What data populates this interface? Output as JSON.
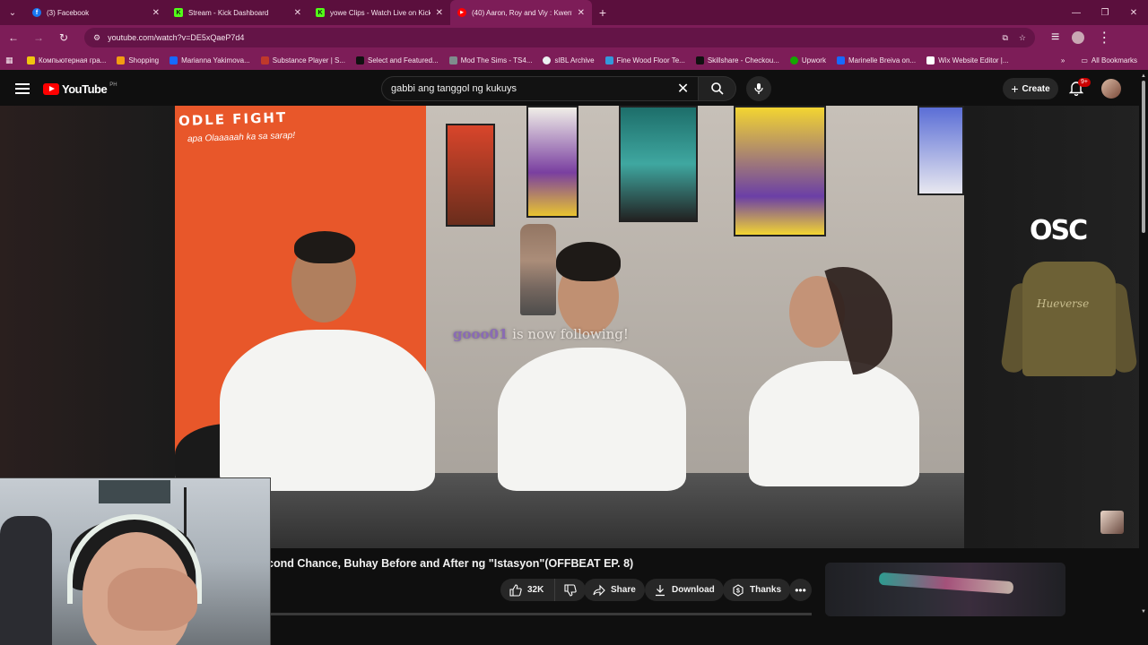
{
  "browser": {
    "tabs": [
      {
        "label": "(3) Facebook",
        "fav_color": "#1877f2",
        "fav_glyph": "f"
      },
      {
        "label": "Stream - Kick Dashboard",
        "fav_color": "#53fc18",
        "fav_glyph": "K"
      },
      {
        "label": "yowe Clips - Watch Live on Kick",
        "fav_color": "#53fc18",
        "fav_glyph": "K"
      },
      {
        "label": "(40) Aaron, Roy and Viy : Kwent",
        "fav_color": "#ff0000",
        "fav_glyph": "▶"
      }
    ],
    "url": "youtube.com/watch?v=DE5xQaeP7d4",
    "bookmarks": [
      {
        "label": "Компьютерная гра...",
        "color": "#f1c40f"
      },
      {
        "label": "Shopping",
        "color": "#f39c12"
      },
      {
        "label": "Marianna Yakimova...",
        "color": "#1769ff"
      },
      {
        "label": "Substance Player | S...",
        "color": "#c0392b"
      },
      {
        "label": "Select and Featured...",
        "color": "#111111"
      },
      {
        "label": "Mod The Sims - TS4...",
        "color": "#7f8c8d"
      },
      {
        "label": "sIBL Archive",
        "color": "#ecf0f1"
      },
      {
        "label": "Fine Wood Floor Te...",
        "color": "#3498db"
      },
      {
        "label": "Skillshare - Checkou...",
        "color": "#111111"
      },
      {
        "label": "Upwork",
        "color": "#14a800"
      },
      {
        "label": "Marinelle Breiva on...",
        "color": "#1769ff"
      },
      {
        "label": "Wix Website Editor |...",
        "color": "#ffffff"
      }
    ],
    "all_bookmarks": "All Bookmarks"
  },
  "youtube": {
    "logo_text": "YouTube",
    "country": "PH",
    "search_query": "gabbi ang tanggol ng kukuys",
    "create_label": "Create",
    "notif_badge": "9+"
  },
  "video": {
    "sign_line1": "ODLE FIGHT",
    "sign_line2": "apa Olaaaaah ka sa sarap!",
    "follow_name": "gooo01",
    "follow_text": " is now following!",
    "title": "cond Chance, Buhay Before and After ng \"Istasyon\"(OFFBEAT EP. 8)",
    "likes": "32K",
    "share_label": "Share",
    "download_label": "Download",
    "thanks_label": "Thanks"
  },
  "ad": {
    "logo": "OSC",
    "jacket_text": "Hueverse"
  }
}
